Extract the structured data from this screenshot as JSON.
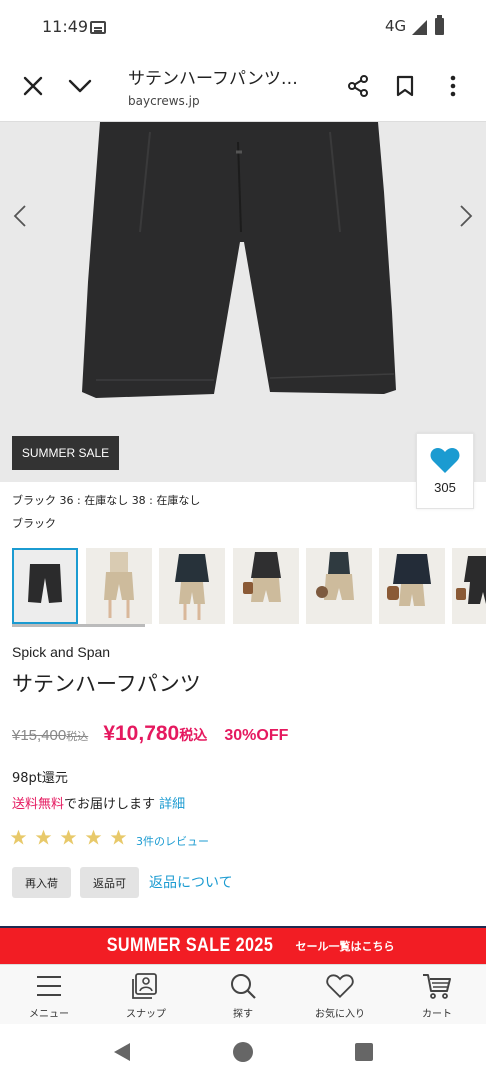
{
  "status_bar": {
    "time": "11:49",
    "network": "4G"
  },
  "toolbar": {
    "title": "サテンハーフパンツ…",
    "domain": "baycrews.jp"
  },
  "hero": {
    "badge": "SUMMER SALE",
    "favorite_count": "305"
  },
  "stock": {
    "line": "ブラック 36 : 在庫なし 38 : 在庫なし",
    "color": "ブラック"
  },
  "product": {
    "brand": "Spick and Span",
    "name": "サテンハーフパンツ",
    "original_price": "¥15,400",
    "original_tax": "税込",
    "sale_price": "¥10,780",
    "sale_tax": "税込",
    "discount": "30%OFF",
    "points": "98pt還元",
    "shipping_free": "送料無料",
    "shipping_text": "でお届けします",
    "shipping_link": "詳細",
    "rating_stars": 5,
    "review_link": "3件のレビュー",
    "tags": [
      "再入荷",
      "返品可"
    ],
    "returns_link": "返品について"
  },
  "banner": {
    "title": "SUMMER SALE 2025",
    "sub": "セール一覧はこちら"
  },
  "bottom_nav": [
    {
      "label": "メニュー",
      "icon": "menu-icon"
    },
    {
      "label": "スナップ",
      "icon": "snap-icon"
    },
    {
      "label": "探す",
      "icon": "search-icon"
    },
    {
      "label": "お気に入り",
      "icon": "heart-icon"
    },
    {
      "label": "カート",
      "icon": "cart-icon"
    }
  ],
  "colors": {
    "accent": "#1b9bd1",
    "sale": "#e5195f",
    "banner": "#f21d24",
    "star": "#e8c96a"
  }
}
